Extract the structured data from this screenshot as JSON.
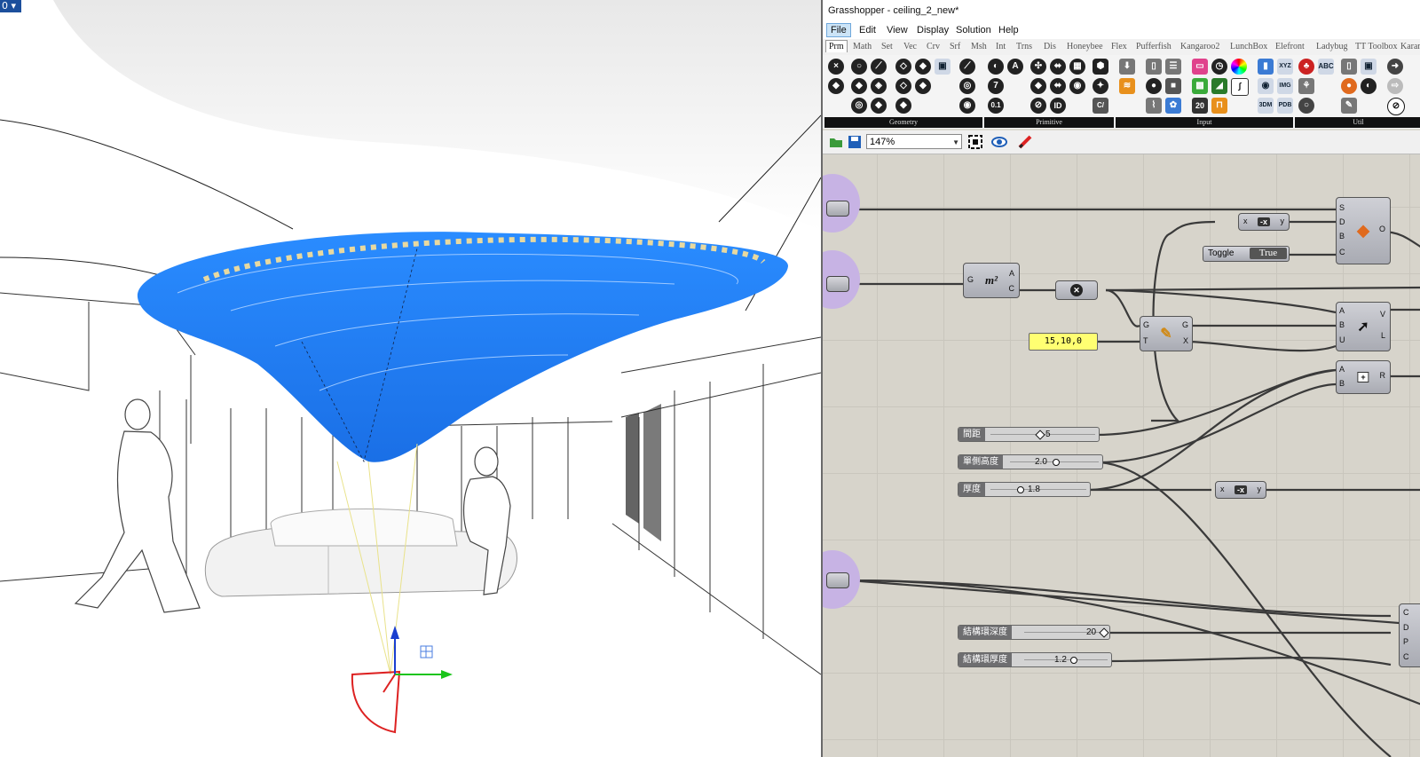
{
  "viewport": {
    "menu_label": "0",
    "colors": {
      "surface": "#1f7ef0",
      "highlight": "#e8d9a0"
    }
  },
  "grasshopper": {
    "title": "Grasshopper - ceiling_2_new*",
    "menu": [
      "File",
      "Edit",
      "View",
      "Display",
      "Solution",
      "Help"
    ],
    "active_menu": "File",
    "tabs": [
      "Prm",
      "Math",
      "Set",
      "Vec",
      "Crv",
      "Srf",
      "Msh",
      "Int",
      "Trns",
      "Dis",
      "Honeybee",
      "Flex",
      "Pufferfish",
      "Kangaroo2",
      "LunchBox",
      "Elefront",
      "Ladybug",
      "TT Toolbox",
      "Karam"
    ],
    "active_tab": "Prm",
    "ribbon_groups": [
      "Geometry",
      "Primitive",
      "Input",
      "Util"
    ],
    "ribbon_icons": {
      "prim_0_1": "0.1",
      "prim_7": "7",
      "prim_id": "ID",
      "prim_cf": "C/",
      "input_20": "20",
      "input_img": "IMG",
      "input_3dm": "3DM",
      "input_pdb": "PDB",
      "input_xyz": "XYZ"
    },
    "zoom": "147%",
    "canvas": {
      "panel_value": "15,10,0",
      "toggle": {
        "label": "Toggle",
        "value": "True"
      },
      "area_component": {
        "in": "G",
        "glyph": "m²",
        "out_a": "A",
        "out_c": "C"
      },
      "ptgrid_component": {
        "in_g": "G",
        "in_t": "T",
        "out_g": "G",
        "out_x": "X"
      },
      "output_component": {
        "in_s": "S",
        "in_d": "D",
        "in_b": "B",
        "in_c": "C",
        "out": "O"
      },
      "vector_component": {
        "in_a": "A",
        "in_b": "B",
        "in_u": "U",
        "out_v": "V",
        "out_l": "L"
      },
      "add_component": {
        "in_a": "A",
        "in_b": "B",
        "glyph": "+",
        "out": "R"
      },
      "bottom_right_component": {
        "pins": [
          "C",
          "D",
          "P",
          "C"
        ]
      },
      "expr1": {
        "x": "x",
        "op": "-x",
        "y": "y"
      },
      "expr2": {
        "x": "x",
        "op": "-x",
        "y": "y"
      },
      "sliders": [
        {
          "name": "間距",
          "value": "5"
        },
        {
          "name": "單側高度",
          "value": "2.0"
        },
        {
          "name": "厚度",
          "value": "1.8"
        },
        {
          "name": "結構環深度",
          "value": "20"
        },
        {
          "name": "結構環厚度",
          "value": "1.2"
        }
      ]
    }
  }
}
